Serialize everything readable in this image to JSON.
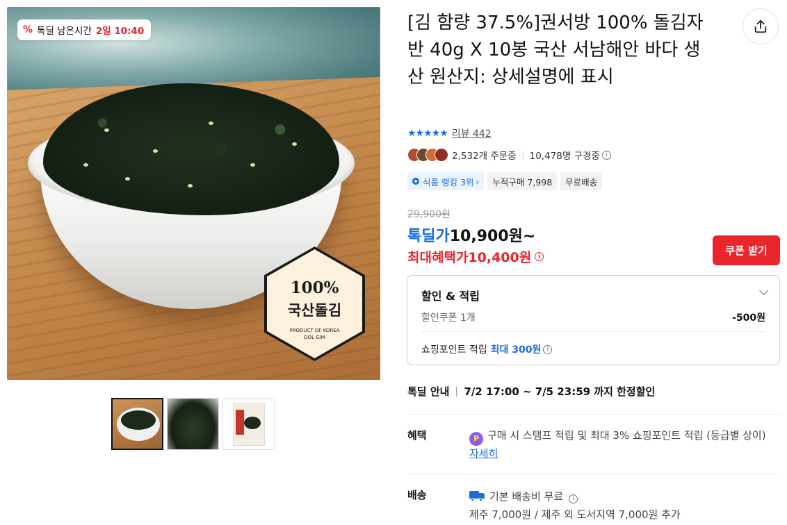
{
  "timer_badge": {
    "label": "톡딜 남은시간",
    "remaining": "2일 10:40"
  },
  "product_image": {
    "badge_line1": "100%",
    "badge_line2": "국산돌김",
    "badge_small_line1": "PRODUCT OF KOREA",
    "badge_small_line2": "DOL GIM"
  },
  "thumbnails": [
    {
      "name": "bowl",
      "selected": true
    },
    {
      "name": "seaweed-closeup",
      "selected": false
    },
    {
      "name": "package",
      "selected": false
    }
  ],
  "product": {
    "title": "[김 함량 37.5%]권서방 100% 돌김자반 40g X 10봉 국산 서남해안 바다 생산 원산지: 상세설명에 표시",
    "rating_stars": 4.5,
    "stars_text": "★★★★★",
    "review_link": "리뷰 442",
    "order_count": "2,532개 주문중",
    "viewer_count": "10,478명 구경중",
    "tags": {
      "ranking": "식품 랭킹 3위",
      "ranking_arrow": "›",
      "cumulative": "누적구매 7,998",
      "free_shipping": "무료배송"
    }
  },
  "pricing": {
    "original": "29,900원",
    "deal_label": "톡딜가",
    "deal_value": "10,900원~",
    "max_label": "최대혜택가",
    "max_value": "10,400원",
    "coupon_button": "쿠폰 받기"
  },
  "benefit_box": {
    "header": "할인 & 적립",
    "coupon_label": "할인쿠폰 1개",
    "coupon_value": "-500원",
    "points_label": "쇼핑포인트 적립",
    "points_value": "최대 300원"
  },
  "deal_info": {
    "label": "톡딜 안내",
    "period": "7/2 17:00 ~ 7/5 23:59 까지 한정할인"
  },
  "benefits_section": {
    "label": "혜택",
    "icon_text": "P",
    "text": "구매 시 스탬프 적립 및 최대 3% 쇼핑포인트 적립 (등급별 상이)",
    "link": "자세히"
  },
  "shipping_section": {
    "label": "배송",
    "line1": "기본 배송비 무료",
    "line2": "제주 7,000원 / 제주 외 도서지역 7,000원 추가"
  },
  "colors": {
    "brand_blue": "#1a6cd9",
    "deal_red": "#e8262c"
  },
  "icons": {
    "share": "share-icon",
    "info": "info-icon",
    "chevron": "chevron-down-icon",
    "truck": "truck-icon",
    "point": "point-icon",
    "percent": "percent-icon"
  }
}
